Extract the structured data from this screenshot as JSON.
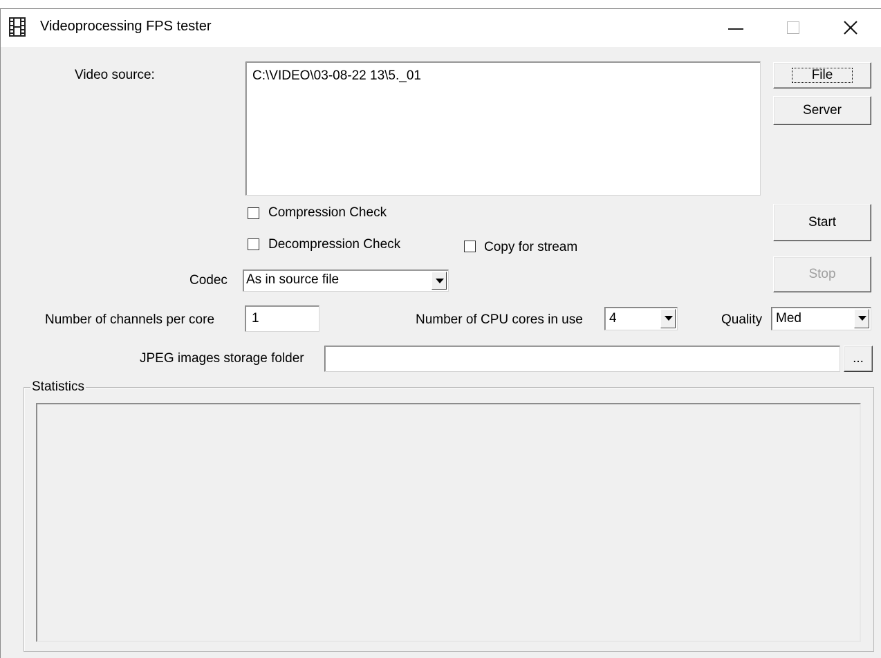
{
  "window": {
    "title": "Videoprocessing FPS tester",
    "icons": {
      "app": "film-icon",
      "minimize": "minimize-icon",
      "maximize": "maximize-icon",
      "close": "close-icon"
    }
  },
  "source": {
    "label": "Video source:",
    "value": "C:\\VIDEO\\03-08-22 13\\5._01"
  },
  "buttons": {
    "file": "File",
    "server": "Server",
    "start": "Start",
    "stop": "Stop",
    "browse": "..."
  },
  "checks": {
    "compression": {
      "label": "Compression Check",
      "checked": false
    },
    "decompression": {
      "label": "Decompression Check",
      "checked": false
    },
    "copy_stream": {
      "label": "Copy for stream",
      "checked": false
    }
  },
  "codec": {
    "label": "Codec",
    "value": "As in source file"
  },
  "channels": {
    "label": "Number of channels per core",
    "value": "1"
  },
  "cores": {
    "label": "Number of CPU cores in use",
    "value": "4"
  },
  "quality": {
    "label": "Quality",
    "value": "Med"
  },
  "jpeg": {
    "label": "JPEG images storage folder",
    "value": ""
  },
  "statistics": {
    "label": "Statistics"
  }
}
